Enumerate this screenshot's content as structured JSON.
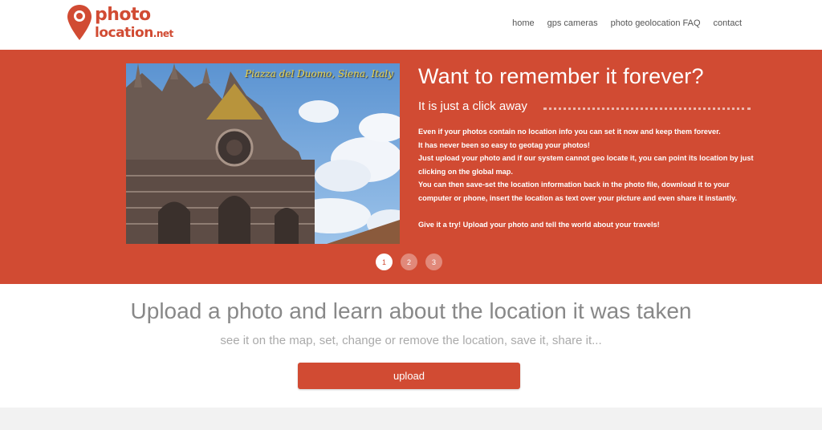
{
  "logo": {
    "line1": "photo",
    "line2": "location",
    "tld": ".net"
  },
  "nav": [
    {
      "label": "home"
    },
    {
      "label": "gps cameras"
    },
    {
      "label": "photo geolocation FAQ"
    },
    {
      "label": "contact"
    }
  ],
  "hero": {
    "photo_caption": "Piazza del Duomo, Siena, Italy",
    "title": "Want to remember it forever?",
    "subtitle": "It is just a click away",
    "paragraphs": [
      "Even if your photos contain no location info you can set it now and keep them forever.",
      "It has never been so easy to geotag your photos!",
      "Just upload your photo and if our system cannot geo locate it, you can point its location by just clicking on the global map.",
      "You can then save-set the location information back in the photo file, download it to your computer or phone, insert the location as text over your picture and even share it instantly."
    ],
    "cta": "Give it a try! Upload your photo and tell the world about your travels!",
    "slides": [
      "1",
      "2",
      "3"
    ]
  },
  "main": {
    "title": "Upload a photo and learn about the location it was taken",
    "subtitle": "see it on the map, set, change or remove the location, save it, share it...",
    "upload_label": "upload"
  },
  "colors": {
    "accent": "#d14b33",
    "background": "#ffffff"
  }
}
